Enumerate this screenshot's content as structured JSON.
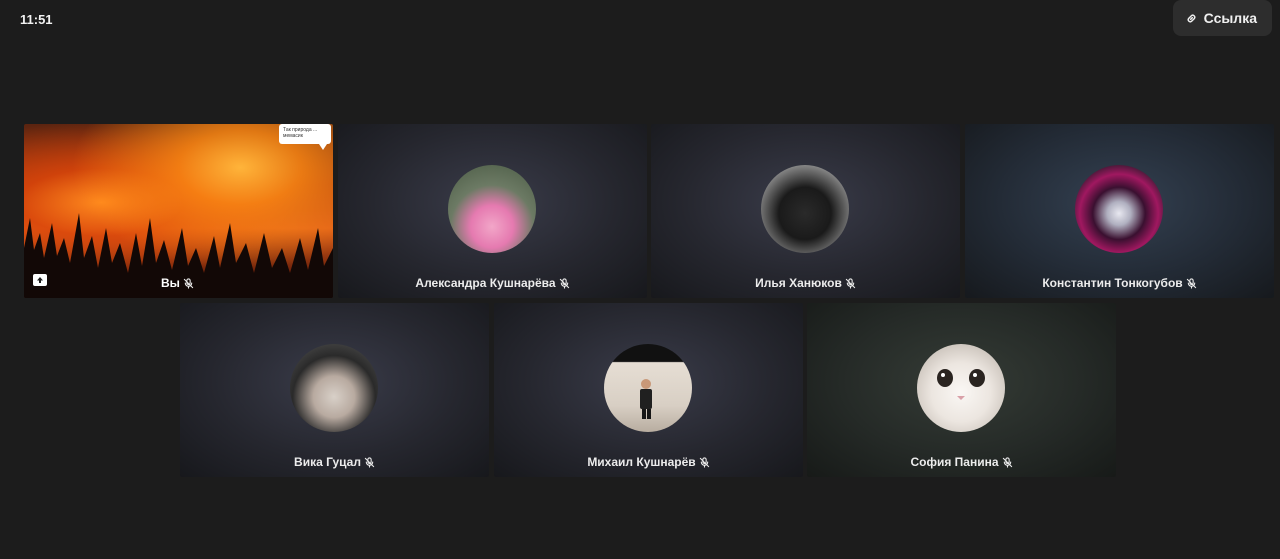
{
  "status": {
    "time": "11:51"
  },
  "header": {
    "link_button_label": "Ссылка"
  },
  "self_tile": {
    "name": "Вы",
    "bubble_text": "Так природа ... мемасик"
  },
  "participants": [
    {
      "name": "Александра Кушнарёва",
      "avatar": "girl-with-cake-avatar"
    },
    {
      "name": "Илья Ханюков",
      "avatar": "soldier-avatar"
    },
    {
      "name": "Константин Тонкогубов",
      "avatar": "skull-avatar"
    },
    {
      "name": "Вика Гуцал",
      "avatar": "anime-character-avatar"
    },
    {
      "name": "Михаил Кушнарёв",
      "avatar": "boy-photo-avatar"
    },
    {
      "name": "София Панина",
      "avatar": "cat-avatar"
    }
  ],
  "icons": {
    "mic_muted": "mic-off-icon",
    "link": "link-icon",
    "screen_share": "upload-icon"
  },
  "colors": {
    "background": "#1c1c1c",
    "tile_dark": "#26272f",
    "button_bg": "#2d2d2d"
  }
}
